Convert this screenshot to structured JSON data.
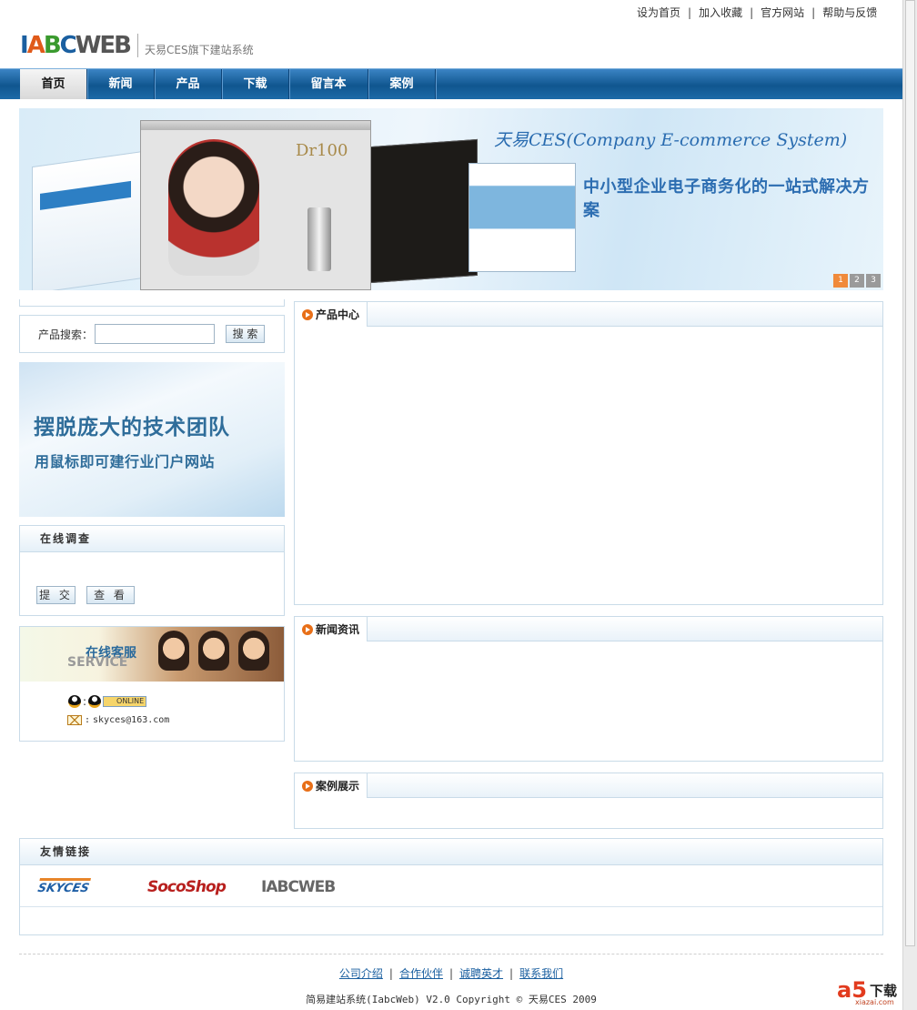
{
  "toplinks": [
    "设为首页",
    "加入收藏",
    "官方网站",
    "帮助与反馈"
  ],
  "logo": {
    "mark": "IABCWEB",
    "tagline": "天易CES旗下建站系统"
  },
  "nav": [
    "首页",
    "新闻",
    "产品",
    "下载",
    "留言本",
    "案例"
  ],
  "banner": {
    "headline": "天易CES(Company E-commerce System)",
    "subline": "中小型企业电子商务化的一站式解决方案",
    "mock_brand": "Dr100",
    "pages": [
      "1",
      "2",
      "3"
    ],
    "active_page": "1"
  },
  "search": {
    "label": "产品搜索：",
    "button": "搜 索",
    "value": ""
  },
  "promo": {
    "line1": "摆脱庞大的技术团队",
    "line2": "用鼠标即可建行业门户网站"
  },
  "survey": {
    "title": "在线调查",
    "submit": "提 交",
    "view": "查 看"
  },
  "service": {
    "title_cn": "在线客服",
    "title_en": "SERVICE",
    "online": "ONLINE",
    "email": "skyces@163.com"
  },
  "sections": {
    "products": "产品中心",
    "news": "新闻资讯",
    "cases": "案例展示"
  },
  "links": {
    "title": "友情链接",
    "logos": [
      "SKYCES",
      "SocoShop",
      "IABCWEB"
    ]
  },
  "footer": {
    "links": [
      "公司介绍",
      "合作伙伴",
      "诚聘英才",
      "联系我们"
    ],
    "copyright": "简易建站系统(IabcWeb) V2.0  Copyright © 天易CES 2009"
  },
  "watermark": {
    "brand": "a5",
    "text": "下载",
    "url": "xiazai.com"
  }
}
